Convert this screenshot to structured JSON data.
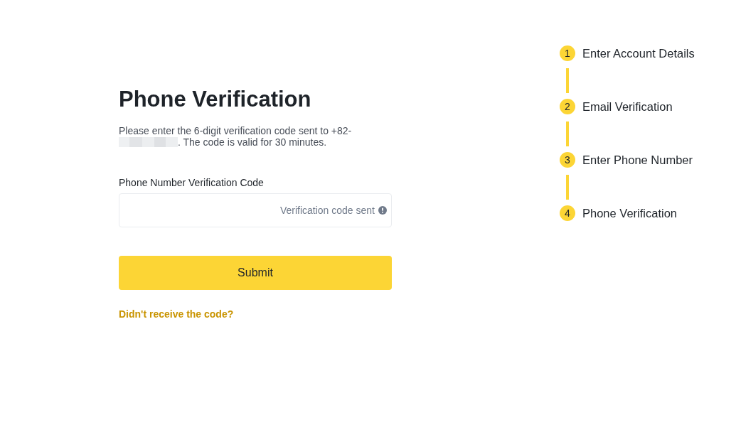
{
  "title": "Phone Verification",
  "description": {
    "line_1": "Please enter the 6-digit verification code sent to +82-",
    "phone_redacted": true,
    "line_2": ". The code is valid for 30 minutes."
  },
  "code_field": {
    "label": "Phone Number Verification Code",
    "status": "Verification code sent"
  },
  "submit_button": "Submit",
  "resend_link": "Didn't receive the code?",
  "steps": [
    {
      "number": "1",
      "label": "Enter Account Details"
    },
    {
      "number": "2",
      "label": "Email Verification"
    },
    {
      "number": "3",
      "label": "Enter Phone Number"
    },
    {
      "number": "4",
      "label": "Phone Verification"
    }
  ]
}
